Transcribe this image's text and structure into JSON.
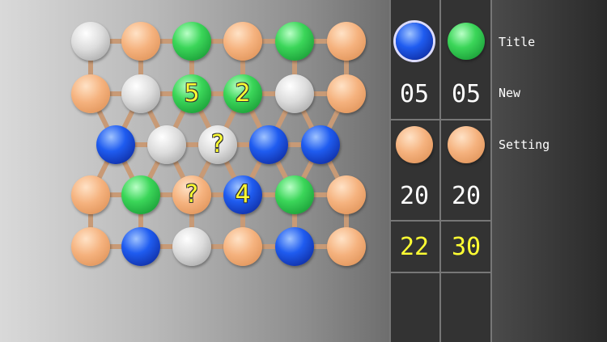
{
  "colors": {
    "orange": "#f5b27e",
    "green": "#3bd659",
    "blue": "#1f5cf0",
    "white": "#dcdcdc",
    "link": "#c89a76",
    "number": "#ffff33"
  },
  "board": {
    "rows": [
      [
        {
          "c": "white"
        },
        {
          "c": "orange"
        },
        {
          "c": "green"
        },
        {
          "c": "orange"
        },
        {
          "c": "green"
        },
        {
          "c": "orange"
        }
      ],
      [
        {
          "c": "orange"
        },
        {
          "c": "white"
        },
        {
          "c": "green",
          "n": "5"
        },
        {
          "c": "green",
          "n": "2"
        },
        {
          "c": "white"
        },
        {
          "c": "orange"
        }
      ],
      [
        {
          "c": "blue"
        },
        {
          "c": "white"
        },
        {
          "c": "white",
          "n": "?"
        },
        {
          "c": "blue"
        },
        {
          "c": "blue"
        }
      ],
      [
        {
          "c": "orange"
        },
        {
          "c": "green"
        },
        {
          "c": "orange",
          "n": "?"
        },
        {
          "c": "blue",
          "n": "4"
        },
        {
          "c": "green"
        },
        {
          "c": "orange"
        }
      ],
      [
        {
          "c": "orange"
        },
        {
          "c": "blue"
        },
        {
          "c": "white"
        },
        {
          "c": "orange"
        },
        {
          "c": "blue"
        },
        {
          "c": "orange"
        }
      ]
    ]
  },
  "panel": {
    "blue_left": "05",
    "blue_right": "05",
    "orange_left": "20",
    "orange_right": "20",
    "score_left": "22",
    "score_right": "30"
  },
  "menu": {
    "title": "Title",
    "new": "New",
    "setting": "Setting"
  }
}
